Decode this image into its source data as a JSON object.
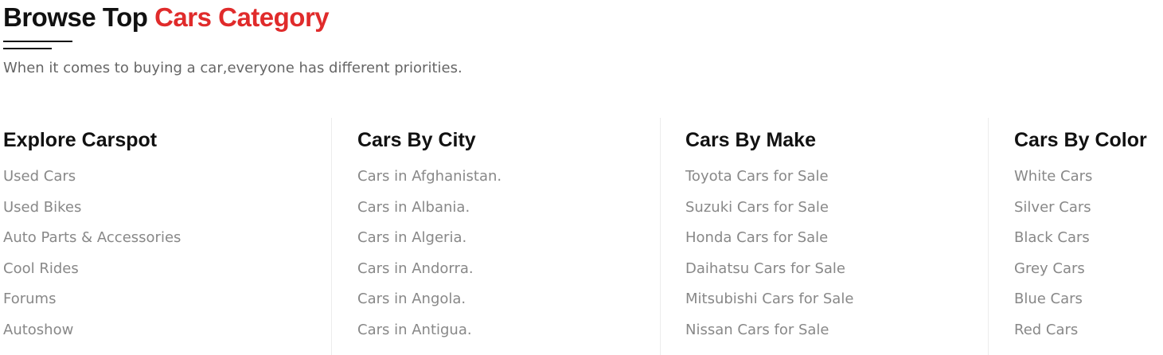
{
  "header": {
    "title_plain": "Browse Top ",
    "title_accent": "Cars Category",
    "subtitle": "When it comes to buying a car,everyone has different priorities."
  },
  "colors": {
    "accent": "#e02b2b",
    "heading": "#111111",
    "link": "#888888",
    "subtitle": "#666666"
  },
  "columns": [
    {
      "title": "Explore Carspot",
      "links": [
        "Used Cars",
        "Used Bikes",
        "Auto Parts & Accessories",
        "Cool Rides",
        "Forums",
        "Autoshow"
      ]
    },
    {
      "title": "Cars By City",
      "links": [
        "Cars in Afghanistan.",
        "Cars in Albania.",
        "Cars in Algeria.",
        "Cars in Andorra.",
        "Cars in Angola.",
        "Cars in Antigua."
      ]
    },
    {
      "title": "Cars By Make",
      "links": [
        "Toyota Cars for Sale",
        "Suzuki Cars for Sale",
        "Honda Cars for Sale",
        "Daihatsu Cars for Sale",
        "Mitsubishi Cars for Sale",
        "Nissan Cars for Sale"
      ]
    },
    {
      "title": "Cars By Color",
      "links": [
        "White Cars",
        "Silver Cars",
        "Black Cars",
        "Grey Cars",
        "Blue Cars",
        "Red Cars"
      ]
    }
  ]
}
